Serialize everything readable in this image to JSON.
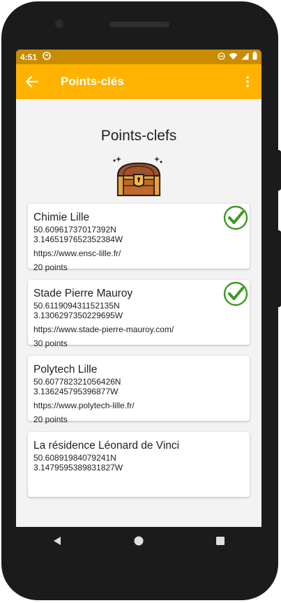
{
  "status_bar": {
    "time": "4:51"
  },
  "app_bar": {
    "title": "Points-clés"
  },
  "page": {
    "heading": "Points-clefs"
  },
  "points": [
    {
      "name": "Chimie Lille",
      "latitude": "50.60961737017392N",
      "longitude": "3.1465197652352384W",
      "url": "https://www.ensc-lille.fr/",
      "points": "20 points",
      "visited": true
    },
    {
      "name": "Stade Pierre Mauroy",
      "latitude": "50.611909431152135N",
      "longitude": "3.1306297350229695W",
      "url": "https://www.stade-pierre-mauroy.com/",
      "points": "30 points",
      "visited": true
    },
    {
      "name": "Polytech Lille",
      "latitude": "50.607782321056426N",
      "longitude": "3.136245795396877W",
      "url": "https://www.polytech-lille.fr/",
      "points": "20 points",
      "visited": false
    },
    {
      "name": "La résidence Léonard de Vinci",
      "latitude": "50.60891984079241N",
      "longitude": "3.1479595389831827W",
      "url": "",
      "points": "",
      "visited": false
    }
  ],
  "colors": {
    "accent": "#ffb300",
    "status_bar": "#c88c00",
    "check_green": "#3a9a1f"
  }
}
